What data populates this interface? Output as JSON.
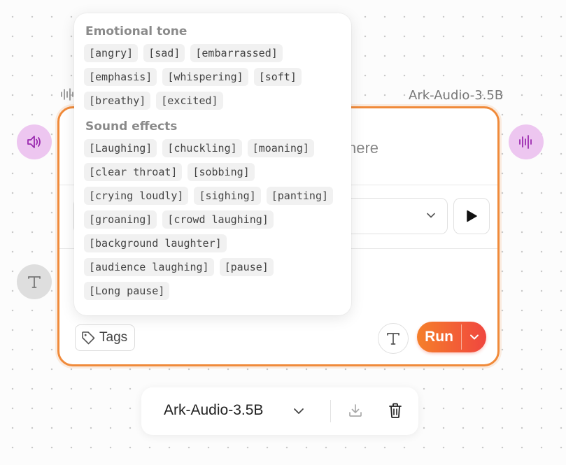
{
  "node": {
    "label": "Ark-Audio-3.5B"
  },
  "card": {
    "placeholder_fragment": "here",
    "tags_label": "Tags",
    "run_label": "Run"
  },
  "popover": {
    "emotional_tone": {
      "title": "Emotional tone",
      "tags": [
        "[angry]",
        "[sad]",
        "[embarrassed]",
        "[emphasis]",
        "[whispering]",
        "[soft]",
        "[breathy]",
        "[excited]"
      ]
    },
    "sound_effects": {
      "title": "Sound effects",
      "tags": [
        "[Laughing]",
        "[chuckling]",
        "[moaning]",
        "[clear throat]",
        "[sobbing]",
        "[crying loudly]",
        "[sighing]",
        "[panting]",
        "[groaning]",
        "[crowd laughing]",
        "[background laughter]",
        "[audience laughing]",
        "[pause]",
        "[Long pause]"
      ]
    }
  },
  "bottom_bar": {
    "model_name": "Ark-Audio-3.5B"
  },
  "icons": {
    "speaker": "speaker-icon",
    "waveform": "waveform-icon",
    "text": "text-icon",
    "tag": "tag-icon",
    "play": "play-icon",
    "chevron": "chevron-down-icon",
    "download": "download-icon",
    "trash": "trash-icon"
  },
  "colors": {
    "accent_orange": "#f08a3a",
    "run_gradient_start": "#f57f2a",
    "run_gradient_end": "#f0463f",
    "audio_port_bg": "#edc6f0",
    "audio_port_icon": "#9b2bb0",
    "text_port_bg": "#dedede"
  }
}
